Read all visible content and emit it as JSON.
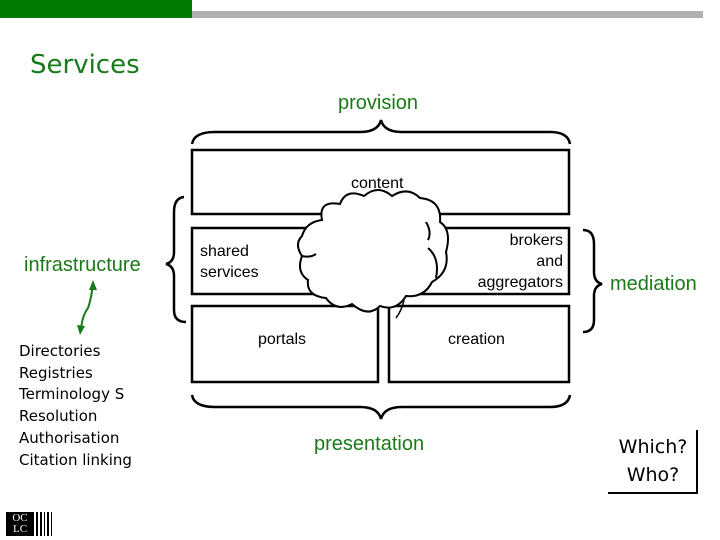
{
  "slide": {
    "title": "Services",
    "colors": {
      "accent_green": "#1a7a1a",
      "bar_green": "#007a00",
      "bar_gray": "#b0b0b0"
    }
  },
  "diagram": {
    "brackets": {
      "top": "provision",
      "bottom": "presentation",
      "left": "infrastructure",
      "right": "mediation"
    },
    "boxes": {
      "content": "content",
      "shared_services": [
        "shared",
        "services"
      ],
      "brokers": [
        "brokers",
        "and",
        "aggregators"
      ],
      "portals": "portals",
      "creation": "creation"
    },
    "cloud_icon": "cloud-icon",
    "arrow_icon": "double-arrow-icon"
  },
  "infrastructure_list": [
    "Directories",
    "Registries",
    "Terminology S",
    "Resolution",
    "Authorisation",
    "Citation linking"
  ],
  "callout": {
    "line1": "Which?",
    "line2": "Who?"
  },
  "logo": {
    "top": "OC",
    "bottom": "LC"
  }
}
